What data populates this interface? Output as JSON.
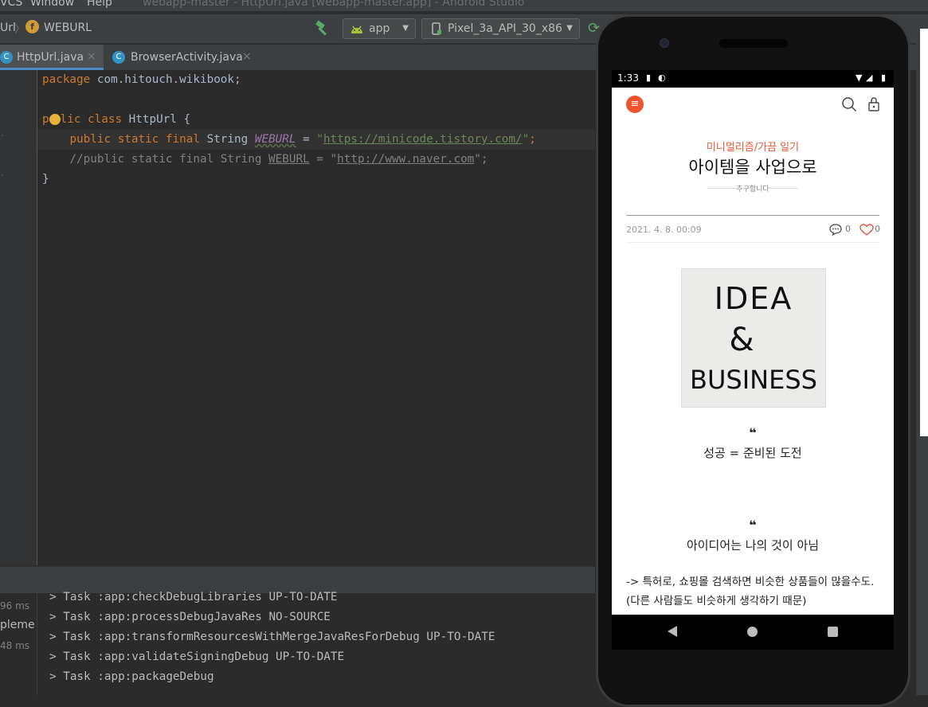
{
  "window": {
    "menus": [
      "VCS",
      "Window",
      "Help"
    ],
    "title": "webapp-master - HttpUrl.java [webapp-master.app] - Android Studio"
  },
  "toolbar": {
    "breadcrumb_file": "Url",
    "breadcrumb_field": "WEBURL",
    "field_badge": "f",
    "run_config": "app",
    "device": "Pixel_3a_API_30_x86"
  },
  "tabs": [
    {
      "label": "HttpUrl.java",
      "icon": "C",
      "close": "×"
    },
    {
      "label": "BrowserActivity.java",
      "icon": "C",
      "close": "×"
    }
  ],
  "code": {
    "line1_kw": "package",
    "line1_rest": " com.hitouch.wikibook;",
    "line3_a": "p",
    "line3_b": "lic class",
    "line3_rest": " HttpUrl {",
    "line4_kw": "public static final",
    "line4_type": " String ",
    "line4_field": "WEBURL",
    "line4_eq": " = ",
    "line4_q1": "\"",
    "line4_url": "https://minicode.tistory.com/",
    "line4_q2": "\"",
    "line4_end": ";",
    "line5_prefix": "    //public static final String ",
    "line5_field": "WEBURL",
    "line5_eq": " = \"",
    "line5_url": "http://www.naver.com",
    "line5_end": "\";",
    "line6": "}"
  },
  "build": {
    "times": [
      "96 ms",
      "48 ms"
    ],
    "side_label": "pleme",
    "lines": [
      "> Task :app:checkDebugLibraries UP-TO-DATE",
      "> Task :app:processDebugJavaRes NO-SOURCE",
      "> Task :app:transformResourcesWithMergeJavaResForDebug UP-TO-DATE",
      "> Task :app:validateSigningDebug UP-TO-DATE",
      "> Task :app:packageDebug"
    ]
  },
  "phone": {
    "time": "1:33",
    "category": "미니멀리즘/가끔 일기",
    "title": "아이템을 사업으로",
    "subtitle": "추구합니다",
    "date": "2021. 4. 8. 00:09",
    "comment_count": "0",
    "like_count": "0",
    "image_lines": [
      "IDEA",
      "&",
      "BUSINESS"
    ],
    "quote_mark": "❝",
    "quote1": "성공 = 준비된 도전",
    "quote2": "아이디어는 나의 것이 아님",
    "body": "-> 특허로, 쇼핑몰 검색하면 비슷한 상품들이 많을수도. (다른 사람들도 비슷하게 생각하기 때문)",
    "accent_color": "#f0542d"
  }
}
